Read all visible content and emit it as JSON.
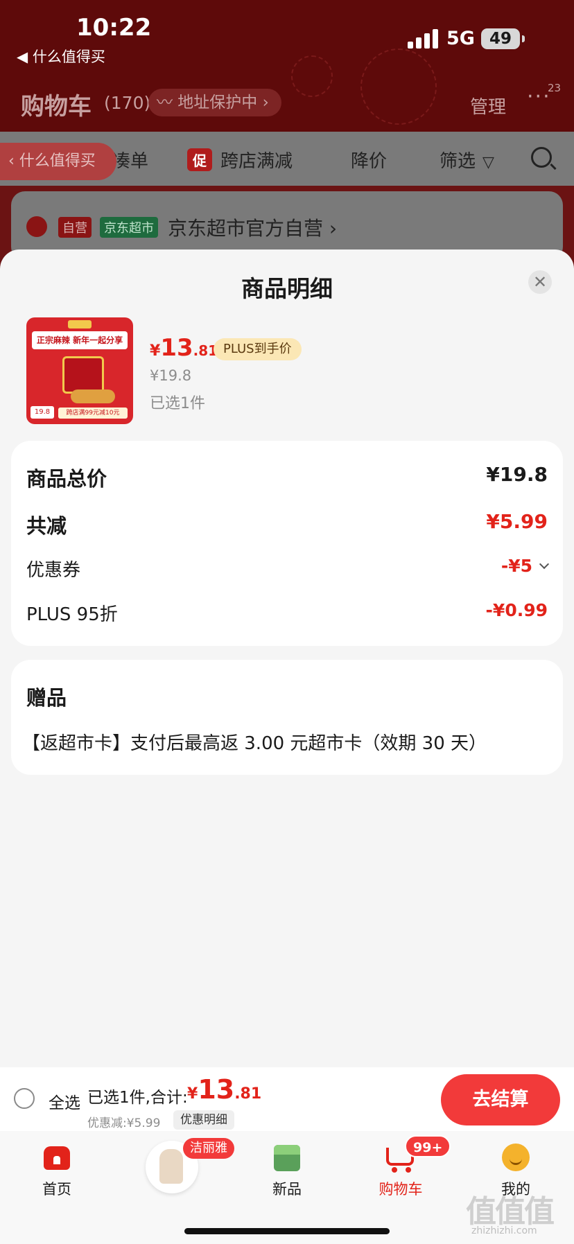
{
  "status_bar": {
    "time": "10:22",
    "back_app": "◀ 什么值得买",
    "network": "5G",
    "battery": "49"
  },
  "header": {
    "title": "购物车",
    "count": "(170)",
    "address_pill": "〰 地址保护中 ›",
    "manage": "管理",
    "more": "···",
    "more_badge": "23"
  },
  "filter_bar": {
    "back_float": "‹ 什么值得买",
    "item_1": "凑单",
    "promo_tag": "促",
    "item_2": "跨店满减",
    "item_3": "降价",
    "item_4": "筛选"
  },
  "shop": {
    "tag_self": "自营",
    "tag_market": "京东超市",
    "name": "京东超市官方自营 ›"
  },
  "sheet": {
    "title": "商品明细",
    "close": "✕",
    "product": {
      "thumb_title": "正宗麻辣 新年一起分享",
      "thumb_price": "19.8",
      "thumb_foot": "跨店满99元减10元",
      "price_currency": "¥",
      "price_int": "13",
      "price_dec": ".81",
      "plus_badge": "PLUS到手价",
      "original_price": "¥19.8",
      "selected": "已选1件"
    },
    "summary": {
      "total_label": "商品总价",
      "total_value": "¥19.8",
      "reduce_label": "共减",
      "reduce_value": "¥5.99",
      "coupon_label": "优惠券",
      "coupon_value": "-¥5",
      "plus_label": "PLUS 95折",
      "plus_value": "-¥0.99"
    },
    "gift": {
      "title": "赠品",
      "text": "【返超市卡】支付后最高返 3.00 元超市卡（效期 30 天）"
    }
  },
  "checkout": {
    "select_all": "全选",
    "total_label": "已选1件,合计:",
    "currency": "¥",
    "total_int": "13",
    "total_dec": ".81",
    "discount": "优惠减:¥5.99",
    "detail_button": "优惠明细",
    "checkout_button": "去结算"
  },
  "tabs": {
    "home": "首页",
    "promo_tag": "洁丽雅",
    "new": "新品",
    "cart": "购物车",
    "cart_badge": "99+",
    "me": "我的"
  },
  "watermark": {
    "main": "值值值",
    "sub": "zhizhizhi.com"
  },
  "colors": {
    "accent_red": "#e2231a",
    "checkout_button": "#f23a3a",
    "plus_badge_bg": "#fbe7b5",
    "header_bg": "#5e0a0a"
  },
  "icons": [
    "search-icon",
    "close-icon",
    "chevron-down-icon",
    "filter-icon",
    "home-icon",
    "cube-icon",
    "cart-icon",
    "me-icon"
  ]
}
